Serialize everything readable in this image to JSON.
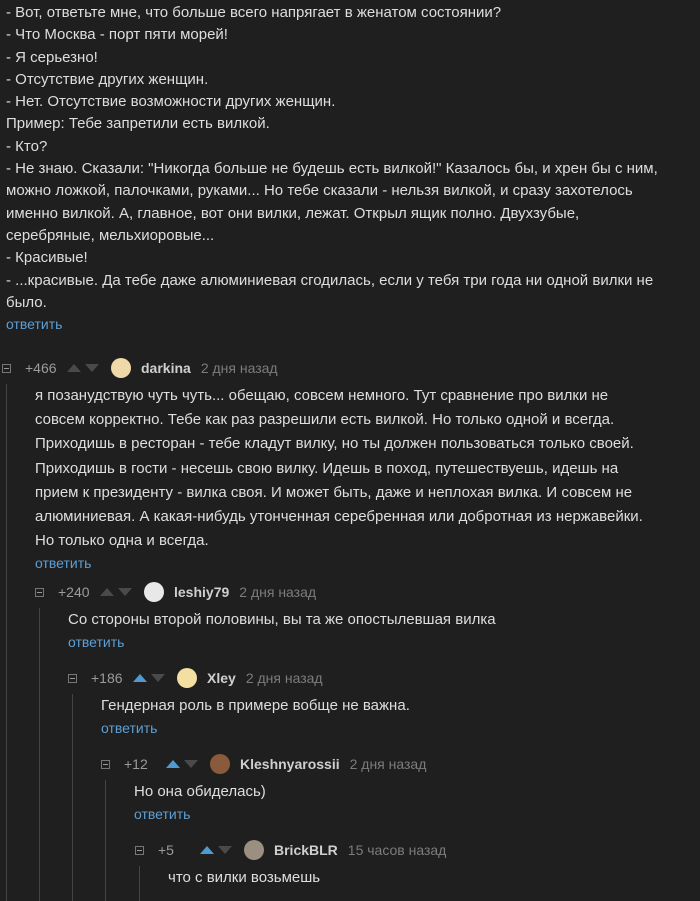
{
  "post": {
    "lines": [
      "- Вот, ответьте мне, что больше всего напрягает в женатом состоянии?",
      "- Что Москва - порт пяти морей!",
      "- Я серьезно!",
      "- Отсутствие других женщин.",
      "- Нет. Отсутствие возможности других женщин.",
      "Пример: Тебе запретили есть вилкой.",
      "- Кто?",
      "- Не знаю. Сказали: \"Никогда больше не будешь есть вилкой!\" Казалось бы, и хрен бы с ним,",
      "можно ложкой, палочками, руками... Но тебе сказали - нельзя вилкой, и сразу захотелось",
      "именно вилкой. А, главное, вот они вилки, лежат. Открыл ящик полно. Двухзубые,",
      "серебряные, мельхиоровые...",
      "- Красивые!",
      "- ...красивые. Да тебе даже алюминиевая сгодилась, если у тебя три года ни одной вилки не",
      "было."
    ],
    "reply_label": "ответить"
  },
  "comments": [
    {
      "rating": "+466",
      "user": "darkina",
      "time": "2 дня назад",
      "upvoted": false,
      "avatar_color": "#f0d9a8",
      "text": "я позанудствую чуть чуть... обещаю, совсем немного. Тут сравнение про вилки не\nсовсем корректно. Тебе как раз разрешили есть вилкой. Но только одной и всегда.\nПриходишь в ресторан - тебе кладут вилку, но ты должен пользоваться только своей.\nПриходишь в гости - несешь свою вилку. Идешь в поход, путешествуешь, идешь на\nприем к президенту - вилка своя. И может быть, даже и неплохая вилка. И совсем не\nалюминиевая. А какая-нибудь утонченная серебренная или добротная из нержавейки.\nНо только одна и всегда.",
      "reply_label": "ответить"
    },
    {
      "rating": "+240",
      "user": "leshiy79",
      "time": "2 дня назад",
      "upvoted": false,
      "avatar_color": "#e8e8e8",
      "text": "Со стороны второй половины, вы та же опостылевшая вилка",
      "reply_label": "ответить"
    },
    {
      "rating": "+186",
      "user": "Xley",
      "time": "2 дня назад",
      "upvoted": true,
      "avatar_color": "#f4dfa2",
      "text": "Гендерная роль в примере вобще не важна.",
      "reply_label": "ответить"
    },
    {
      "rating": "+12",
      "user": "Kleshnyarossii",
      "time": "2 дня назад",
      "upvoted": true,
      "avatar_color": "#8a5a3c",
      "text": "Но она обиделась)",
      "reply_label": "ответить"
    },
    {
      "rating": "+5",
      "user": "BrickBLR",
      "time": "15 часов назад",
      "upvoted": true,
      "avatar_color": "#9a8f80",
      "text": "что с вилки возьмешь",
      "reply_label": ""
    }
  ]
}
